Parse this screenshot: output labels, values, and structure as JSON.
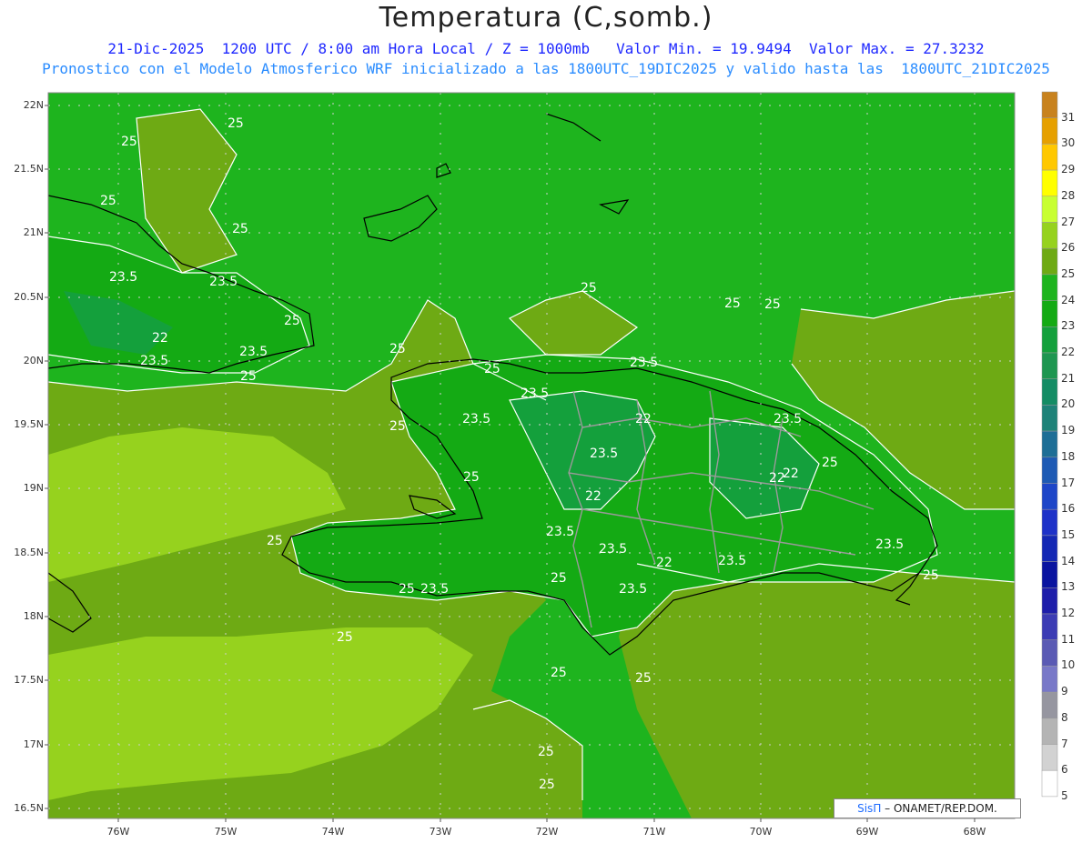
{
  "header": {
    "title": "Temperatura (C,somb.)",
    "line1": "21-Dic-2025  1200 UTC / 8:00 am Hora Local / Z = 1000mb   Valor Min. = 19.9494  Valor Max. = 27.3232",
    "line2": "Pronostico con el Modelo Atmosferico WRF inicializado a las 1800UTC_19DIC2025 y valido hasta las  1800UTC_21DIC2025"
  },
  "axes": {
    "lat_labels": [
      "22N",
      "21.5N",
      "21N",
      "20.5N",
      "20N",
      "19.5N",
      "19N",
      "18.5N",
      "18N",
      "17.5N",
      "17N",
      "16.5N"
    ],
    "lon_labels": [
      "76W",
      "75W",
      "74W",
      "73W",
      "72W",
      "71W",
      "70W",
      "69W",
      "68W"
    ]
  },
  "colorbar": {
    "levels": [
      "31",
      "30",
      "29",
      "28",
      "27",
      "26",
      "25",
      "24",
      "23",
      "22",
      "21",
      "20",
      "19",
      "18",
      "17",
      "16",
      "15",
      "14",
      "13",
      "12",
      "11",
      "10",
      "9",
      "8",
      "7",
      "6",
      "5"
    ],
    "colors": [
      "#c8821e",
      "#e6a000",
      "#ffc800",
      "#ffff00",
      "#c8ff32",
      "#96d21e",
      "#6eaa14",
      "#1eb41e",
      "#14aa14",
      "#14a03c",
      "#1e9650",
      "#148c64",
      "#1e8278",
      "#1e6e96",
      "#1e5ab4",
      "#1e46c8",
      "#1e32c8",
      "#1428b4",
      "#0a14a0",
      "#1e1eaa",
      "#3c3cb4",
      "#5a5ab4",
      "#7878c8",
      "#9696a0",
      "#b4b4b4",
      "#d2d2d2",
      "#ffffff"
    ]
  },
  "contour_labels": [
    "25",
    "25",
    "25",
    "25",
    "25",
    "23.5",
    "23.5",
    "25",
    "22",
    "23.5",
    "23.5",
    "25",
    "25",
    "25",
    "25",
    "23.5",
    "25",
    "23.5",
    "23.5",
    "22",
    "23.5",
    "22",
    "23.5",
    "22",
    "22",
    "25",
    "23.5",
    "23.5",
    "25",
    "25",
    "23.5",
    "23.5",
    "22",
    "23.5",
    "23.5",
    "25",
    "25",
    "25",
    "25",
    "25",
    "25",
    "25"
  ],
  "credit": {
    "brand": "SisΠ",
    "text": " – ONAMET/REP.DOM."
  }
}
